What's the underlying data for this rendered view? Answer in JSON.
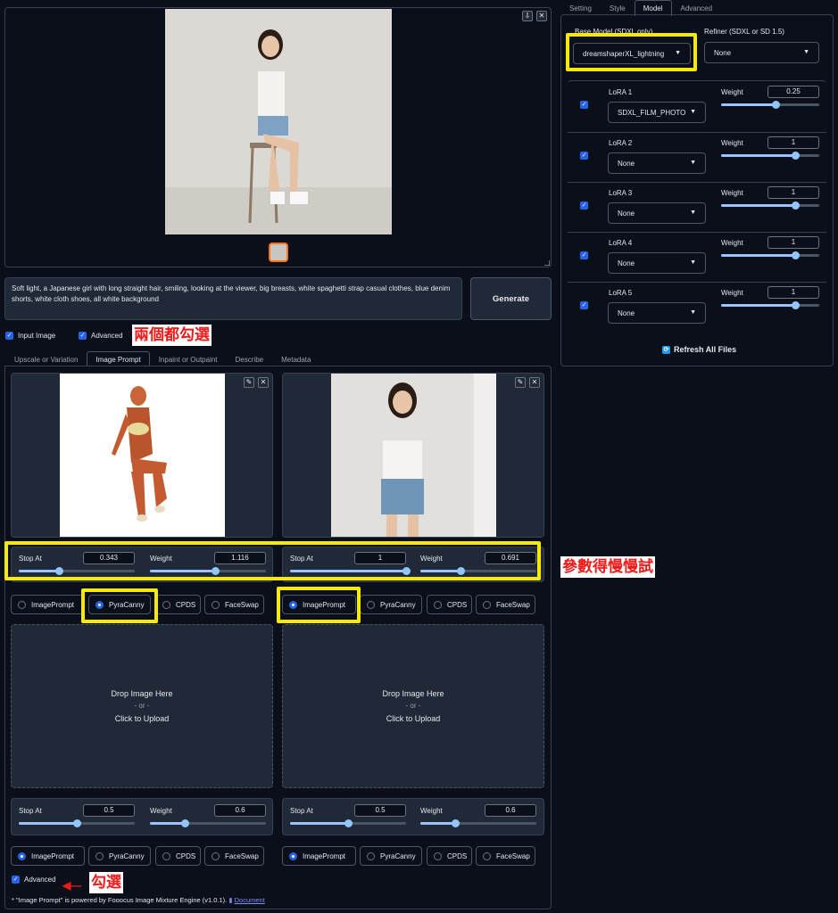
{
  "gallery": {
    "close": "✕",
    "download": "⇩"
  },
  "prompt": {
    "text": "Soft light, a Japanese girl with long straight hair, smiling, looking at the viewer, big breasts, white spaghetti strap casual clothes, blue denim shorts, white cloth shoes, all white background"
  },
  "generate_label": "Generate",
  "checkboxes": {
    "input_image": "Input Image",
    "advanced": "Advanced",
    "advanced_bottom": "Advanced"
  },
  "notes": {
    "both_checked": "兩個都勾選",
    "params_try": "參數得慢慢試",
    "check": "勾選"
  },
  "left_tabs": [
    "Upscale or Variation",
    "Image Prompt",
    "Inpaint or Outpaint",
    "Describe",
    "Metadata"
  ],
  "image_prompts": [
    {
      "stop_label": "Stop At",
      "stop_value": "0.343",
      "stop_frac": 0.343,
      "weight_label": "Weight",
      "weight_value": "1.116",
      "weight_frac": 0.558
    },
    {
      "stop_label": "Stop At",
      "stop_value": "1",
      "stop_frac": 1.0,
      "weight_label": "Weight",
      "weight_value": "0.691",
      "weight_frac": 0.346
    },
    {
      "stop_label": "Stop At",
      "stop_value": "0.5",
      "stop_frac": 0.5,
      "weight_label": "Weight",
      "weight_value": "0.6",
      "weight_frac": 0.3
    },
    {
      "stop_label": "Stop At",
      "stop_value": "0.5",
      "stop_frac": 0.5,
      "weight_label": "Weight",
      "weight_value": "0.6",
      "weight_frac": 0.3
    }
  ],
  "radio_options": [
    "ImagePrompt",
    "PyraCanny",
    "CPDS",
    "FaceSwap"
  ],
  "drop": {
    "line1": "Drop Image Here",
    "line2": "- or -",
    "line3": "Click to Upload"
  },
  "footer": {
    "text": "* \"Image Prompt\" is powered by Fooocus Image Mixture Engine (v1.0.1).",
    "link": "Document"
  },
  "right_tabs": [
    "Setting",
    "Style",
    "Model",
    "Advanced"
  ],
  "model": {
    "base_label": "Base Model (SDXL only)",
    "base_value": "dreamshaperXL_lightning",
    "refiner_label": "Refiner (SDXL or SD 1.5)",
    "refiner_value": "None",
    "loras": [
      {
        "label": "LoRA 1",
        "value": "SDXL_FILM_PHOTOG",
        "weight_label": "Weight",
        "weight": "0.25",
        "frac": 0.55
      },
      {
        "label": "LoRA 2",
        "value": "None",
        "weight_label": "Weight",
        "weight": "1",
        "frac": 0.75
      },
      {
        "label": "LoRA 3",
        "value": "None",
        "weight_label": "Weight",
        "weight": "1",
        "frac": 0.75
      },
      {
        "label": "LoRA 4",
        "value": "None",
        "weight_label": "Weight",
        "weight": "1",
        "frac": 0.75
      },
      {
        "label": "LoRA 5",
        "value": "None",
        "weight_label": "Weight",
        "weight": "1",
        "frac": 0.75
      }
    ],
    "refresh_label": "Refresh All Files"
  },
  "colors": {
    "accent": "#2563eb",
    "highlight": "#f5ea00",
    "annotation": "#ef1b1b"
  }
}
